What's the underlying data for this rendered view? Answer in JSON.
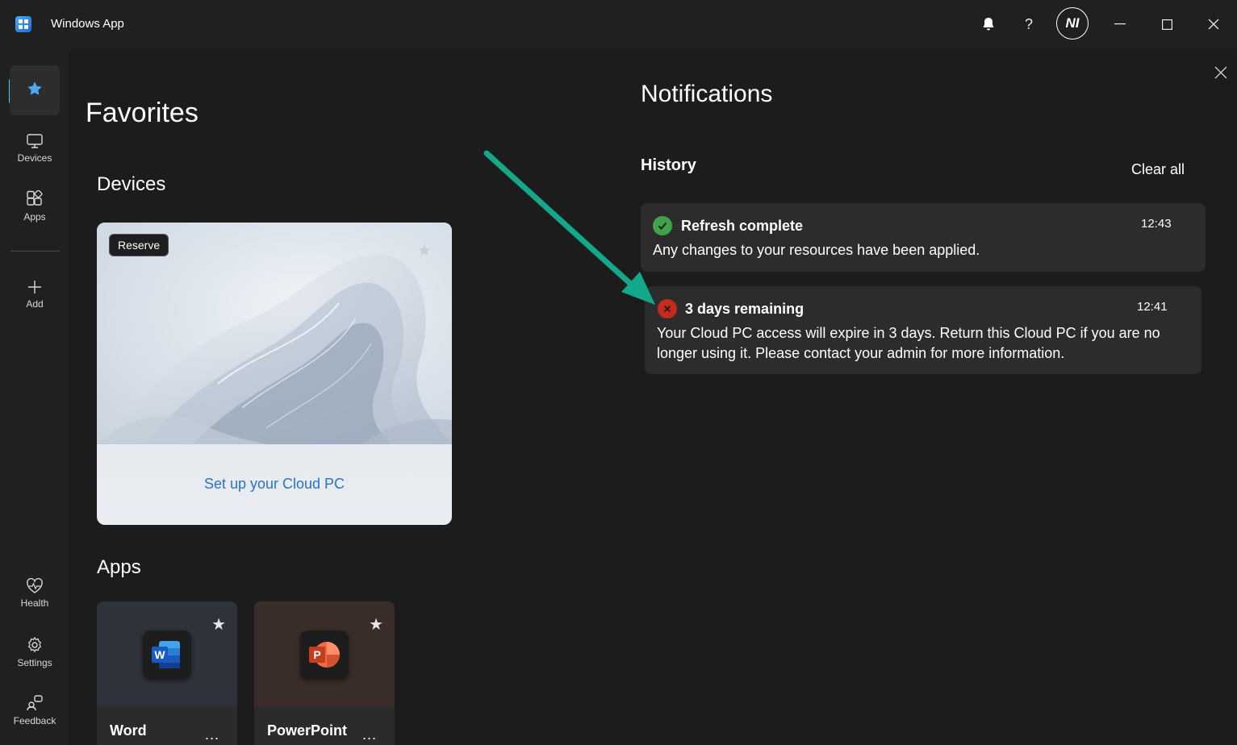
{
  "window": {
    "title": "Windows App",
    "avatar_initials": "NI"
  },
  "rail": {
    "items": [
      {
        "label": "",
        "icon": "star-icon"
      },
      {
        "label": "Devices",
        "icon": "monitor-icon"
      },
      {
        "label": "Apps",
        "icon": "apps-icon"
      },
      {
        "label": "Add",
        "icon": "plus-icon"
      }
    ],
    "bottom_items": [
      {
        "label": "Health",
        "icon": "heart-pulse-icon"
      },
      {
        "label": "Settings",
        "icon": "gear-icon"
      },
      {
        "label": "Feedback",
        "icon": "feedback-icon"
      }
    ]
  },
  "favorites": {
    "title": "Favorites",
    "devices_heading": "Devices",
    "device_card": {
      "badge": "Reserve",
      "action": "Set up your Cloud PC"
    },
    "apps_heading": "Apps",
    "apps": [
      {
        "name": "Word",
        "more": "...",
        "icon": "word-icon"
      },
      {
        "name": "PowerPoint",
        "more": "...",
        "icon": "powerpoint-icon"
      }
    ]
  },
  "notifications": {
    "title": "Notifications",
    "history_label": "History",
    "clear_all": "Clear all",
    "items": [
      {
        "status": "success",
        "title": "Refresh complete",
        "time": "12:43",
        "body": "Any changes to your resources have been applied."
      },
      {
        "status": "error",
        "title": "3 days remaining",
        "time": "12:41",
        "body_line1": "Your Cloud PC access will expire in 3 days. Return this Cloud PC if you are no",
        "body_line2": "longer using it. Please contact your admin for more information."
      }
    ]
  },
  "colors": {
    "accent": "#4cc2ff",
    "success": "#3fa34d",
    "error": "#c42b1c",
    "annotation_arrow": "#14a88a",
    "link": "#2a72c6"
  }
}
